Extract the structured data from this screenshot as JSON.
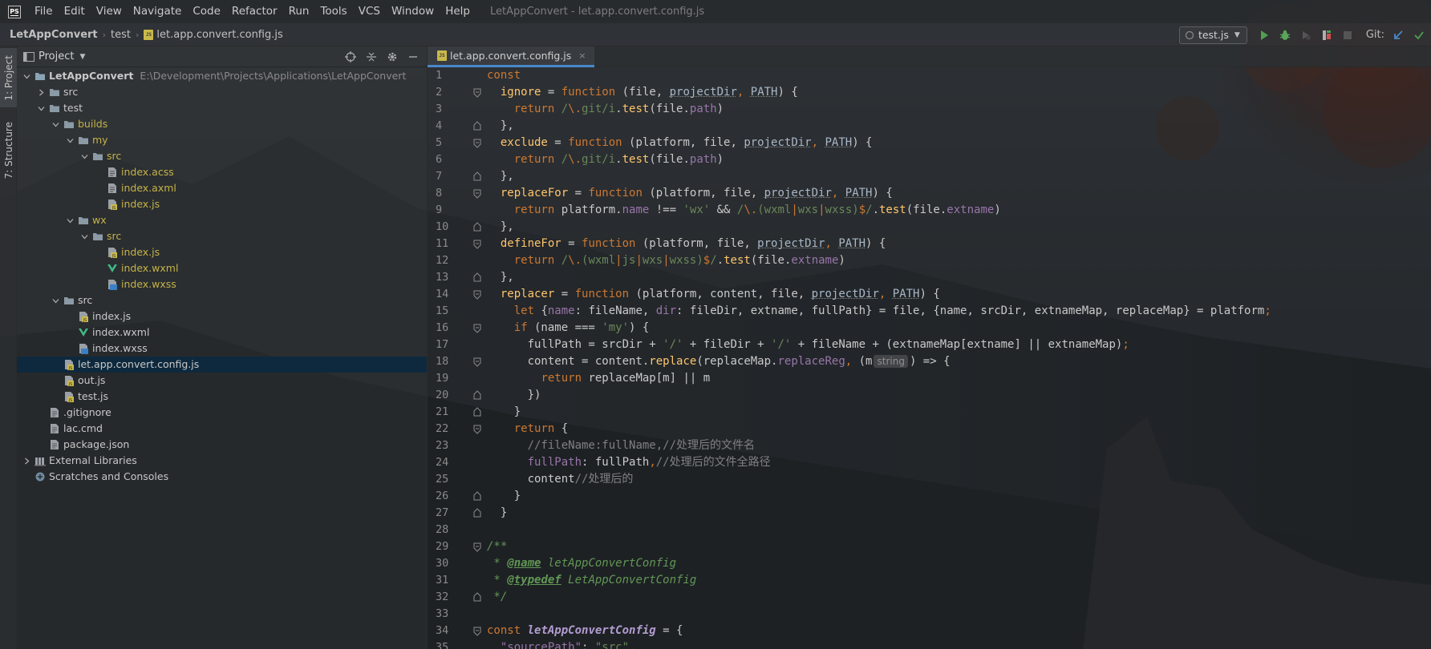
{
  "menu": {
    "app_logo": "PS",
    "items": [
      "File",
      "Edit",
      "View",
      "Navigate",
      "Code",
      "Refactor",
      "Run",
      "Tools",
      "VCS",
      "Window",
      "Help"
    ],
    "window_title": "LetAppConvert - let.app.convert.config.js"
  },
  "navbar": {
    "breadcrumbs": [
      "LetAppConvert",
      "test",
      "let.app.convert.config.js"
    ],
    "run_config": "test.js",
    "git_label": "Git:"
  },
  "tool_stripe": {
    "project_tab": "1: Project",
    "structure_tab": "7: Structure"
  },
  "project_panel": {
    "title": "Project",
    "tree": [
      {
        "label": "LetAppConvert",
        "path": "E:\\Development\\Projects\\Applications\\LetAppConvert",
        "depth": 0,
        "type": "module",
        "expanded": true,
        "bold": true
      },
      {
        "label": "src",
        "depth": 1,
        "type": "folder",
        "expanded": false
      },
      {
        "label": "test",
        "depth": 1,
        "type": "folder",
        "expanded": true
      },
      {
        "label": "builds",
        "depth": 2,
        "type": "folder",
        "expanded": true,
        "excluded": true
      },
      {
        "label": "my",
        "depth": 3,
        "type": "folder",
        "expanded": true,
        "excluded": true
      },
      {
        "label": "src",
        "depth": 4,
        "type": "folder",
        "expanded": true,
        "excluded": true
      },
      {
        "label": "index.acss",
        "depth": 5,
        "type": "file",
        "excluded": true
      },
      {
        "label": "index.axml",
        "depth": 5,
        "type": "file",
        "excluded": true
      },
      {
        "label": "index.js",
        "depth": 5,
        "type": "js",
        "excluded": true
      },
      {
        "label": "wx",
        "depth": 3,
        "type": "folder",
        "expanded": true,
        "excluded": true
      },
      {
        "label": "src",
        "depth": 4,
        "type": "folder",
        "expanded": true,
        "excluded": true
      },
      {
        "label": "index.js",
        "depth": 5,
        "type": "js",
        "excluded": true
      },
      {
        "label": "index.wxml",
        "depth": 5,
        "type": "vue",
        "excluded": true
      },
      {
        "label": "index.wxss",
        "depth": 5,
        "type": "css",
        "excluded": true
      },
      {
        "label": "src",
        "depth": 2,
        "type": "folder",
        "expanded": true
      },
      {
        "label": "index.js",
        "depth": 3,
        "type": "js"
      },
      {
        "label": "index.wxml",
        "depth": 3,
        "type": "vue"
      },
      {
        "label": "index.wxss",
        "depth": 3,
        "type": "css"
      },
      {
        "label": "let.app.convert.config.js",
        "depth": 2,
        "type": "js",
        "selected": true
      },
      {
        "label": "out.js",
        "depth": 2,
        "type": "js"
      },
      {
        "label": "test.js",
        "depth": 2,
        "type": "js"
      },
      {
        "label": ".gitignore",
        "depth": 1,
        "type": "file"
      },
      {
        "label": "lac.cmd",
        "depth": 1,
        "type": "file"
      },
      {
        "label": "package.json",
        "depth": 1,
        "type": "file"
      },
      {
        "label": "External Libraries",
        "depth": 0,
        "type": "libs",
        "expanded": false
      },
      {
        "label": "Scratches and Consoles",
        "depth": 0,
        "type": "scratch"
      }
    ]
  },
  "editor": {
    "tab_label": "let.app.convert.config.js",
    "close_glyph": "×",
    "folds": {
      "2": "o",
      "4": "c",
      "5": "o",
      "7": "c",
      "8": "o",
      "10": "c",
      "11": "o",
      "13": "c",
      "14": "o",
      "16": "o",
      "18": "o",
      "20": "c",
      "21": "c",
      "22": "o",
      "26": "c",
      "27": "c",
      "29": "o",
      "32": "c",
      "34": "o"
    },
    "lines": [
      [
        [
          "const",
          "kw"
        ]
      ],
      [
        [
          "  ",
          ""
        ],
        [
          "ignore",
          "fn"
        ],
        [
          " = ",
          ""
        ],
        [
          "function",
          "kw"
        ],
        [
          " (file, ",
          ""
        ],
        [
          "projectDir",
          "pm"
        ],
        [
          ", ",
          "kw"
        ],
        [
          "PATH",
          "pm"
        ],
        [
          ") {",
          ""
        ]
      ],
      [
        [
          "    ",
          ""
        ],
        [
          "return",
          "kw"
        ],
        [
          " /",
          "rg"
        ],
        [
          "\\.",
          "rm"
        ],
        [
          "git/i",
          "rg"
        ],
        [
          ".",
          ""
        ],
        [
          "test",
          "fn"
        ],
        [
          "(file.",
          ""
        ],
        [
          "path",
          "pr"
        ],
        [
          ")",
          ""
        ]
      ],
      [
        [
          "  },",
          ""
        ]
      ],
      [
        [
          "  ",
          ""
        ],
        [
          "exclude",
          "fn"
        ],
        [
          " = ",
          ""
        ],
        [
          "function",
          "kw"
        ],
        [
          " (platform, file, ",
          ""
        ],
        [
          "projectDir",
          "pm"
        ],
        [
          ", ",
          "kw"
        ],
        [
          "PATH",
          "pm"
        ],
        [
          ") {",
          ""
        ]
      ],
      [
        [
          "    ",
          ""
        ],
        [
          "return",
          "kw"
        ],
        [
          " /",
          "rg"
        ],
        [
          "\\.",
          "rm"
        ],
        [
          "git/i",
          "rg"
        ],
        [
          ".",
          ""
        ],
        [
          "test",
          "fn"
        ],
        [
          "(file.",
          ""
        ],
        [
          "path",
          "pr"
        ],
        [
          ")",
          ""
        ]
      ],
      [
        [
          "  },",
          ""
        ]
      ],
      [
        [
          "  ",
          ""
        ],
        [
          "replaceFor",
          "fn"
        ],
        [
          " = ",
          ""
        ],
        [
          "function",
          "kw"
        ],
        [
          " (platform, file, ",
          ""
        ],
        [
          "projectDir",
          "pm"
        ],
        [
          ", ",
          "kw"
        ],
        [
          "PATH",
          "pm"
        ],
        [
          ") {",
          ""
        ]
      ],
      [
        [
          "    ",
          ""
        ],
        [
          "return",
          "kw"
        ],
        [
          " platform.",
          ""
        ],
        [
          "name",
          "pr"
        ],
        [
          " !== ",
          ""
        ],
        [
          "'wx'",
          "st"
        ],
        [
          " && ",
          ""
        ],
        [
          "/",
          "rg"
        ],
        [
          "\\.",
          "rm"
        ],
        [
          "(",
          "rg"
        ],
        [
          "wxml",
          "rg"
        ],
        [
          "|",
          "rm"
        ],
        [
          "wxs",
          "rg"
        ],
        [
          "|",
          "rm"
        ],
        [
          "wxss)",
          "rg"
        ],
        [
          "$",
          "rm"
        ],
        [
          "/",
          "rg"
        ],
        [
          ".",
          ""
        ],
        [
          "test",
          "fn"
        ],
        [
          "(file.",
          ""
        ],
        [
          "extname",
          "pr"
        ],
        [
          ")",
          ""
        ]
      ],
      [
        [
          "  },",
          ""
        ]
      ],
      [
        [
          "  ",
          ""
        ],
        [
          "defineFor",
          "fn"
        ],
        [
          " = ",
          ""
        ],
        [
          "function",
          "kw"
        ],
        [
          " (platform, file, ",
          ""
        ],
        [
          "projectDir",
          "pm"
        ],
        [
          ", ",
          "kw"
        ],
        [
          "PATH",
          "pm"
        ],
        [
          ") {",
          ""
        ]
      ],
      [
        [
          "    ",
          ""
        ],
        [
          "return",
          "kw"
        ],
        [
          " /",
          "rg"
        ],
        [
          "\\.",
          "rm"
        ],
        [
          "(wxml",
          "rg"
        ],
        [
          "|",
          "rm"
        ],
        [
          "js",
          "rg"
        ],
        [
          "|",
          "rm"
        ],
        [
          "wxs",
          "rg"
        ],
        [
          "|",
          "rm"
        ],
        [
          "wxss)",
          "rg"
        ],
        [
          "$",
          "rm"
        ],
        [
          "/",
          "rg"
        ],
        [
          ".",
          ""
        ],
        [
          "test",
          "fn"
        ],
        [
          "(file.",
          ""
        ],
        [
          "extname",
          "pr"
        ],
        [
          ")",
          ""
        ]
      ],
      [
        [
          "  },",
          ""
        ]
      ],
      [
        [
          "  ",
          ""
        ],
        [
          "replacer",
          "fn"
        ],
        [
          " = ",
          ""
        ],
        [
          "function",
          "kw"
        ],
        [
          " (platform, content, file, ",
          ""
        ],
        [
          "projectDir",
          "pm"
        ],
        [
          ", ",
          "kw"
        ],
        [
          "PATH",
          "pm"
        ],
        [
          ") {",
          ""
        ]
      ],
      [
        [
          "    ",
          ""
        ],
        [
          "let",
          "kw"
        ],
        [
          " {",
          ""
        ],
        [
          "name",
          "pr"
        ],
        [
          ": fileName, ",
          ""
        ],
        [
          "dir",
          "pr"
        ],
        [
          ": fileDir, extname, fullPath} = file, {name, srcDir, extnameMap, replaceMap} = platform",
          ""
        ],
        [
          ";",
          "kw"
        ]
      ],
      [
        [
          "    ",
          ""
        ],
        [
          "if",
          "kw"
        ],
        [
          " (name === ",
          ""
        ],
        [
          "'my'",
          "st"
        ],
        [
          ") {",
          ""
        ]
      ],
      [
        [
          "      fullPath = srcDir + ",
          ""
        ],
        [
          "'/'",
          "st"
        ],
        [
          " + fileDir + ",
          ""
        ],
        [
          "'/'",
          "st"
        ],
        [
          " + fileName + (extnameMap[extname] || extnameMap)",
          ""
        ],
        [
          ";",
          "kw"
        ]
      ],
      [
        [
          "      content = content.",
          ""
        ],
        [
          "replace",
          "fn"
        ],
        [
          "(replaceMap.",
          ""
        ],
        [
          "replaceReg",
          "pr"
        ],
        [
          ", ",
          "kw"
        ],
        [
          "(m",
          ""
        ],
        [
          "HINT:string",
          "hint"
        ],
        [
          ") => {",
          ""
        ]
      ],
      [
        [
          "        ",
          ""
        ],
        [
          "return",
          "kw"
        ],
        [
          " replaceMap[m] || m",
          ""
        ]
      ],
      [
        [
          "      })",
          ""
        ]
      ],
      [
        [
          "    }",
          ""
        ]
      ],
      [
        [
          "    ",
          ""
        ],
        [
          "return",
          "kw"
        ],
        [
          " {",
          ""
        ]
      ],
      [
        [
          "      ",
          ""
        ],
        [
          "//fileName:fullName,//处理后的文件名",
          "cm"
        ]
      ],
      [
        [
          "      ",
          ""
        ],
        [
          "fullPath",
          "pr"
        ],
        [
          ": fullPath",
          ""
        ],
        [
          ",",
          "kw"
        ],
        [
          "//处理后的文件全路径",
          "cm"
        ]
      ],
      [
        [
          "      content",
          ""
        ],
        [
          "//处理后的",
          "cm"
        ]
      ],
      [
        [
          "    }",
          ""
        ]
      ],
      [
        [
          "  }",
          ""
        ]
      ],
      [
        [
          "",
          ""
        ]
      ],
      [
        [
          "/**",
          "jd"
        ]
      ],
      [
        [
          " * ",
          "jd"
        ],
        [
          "@name",
          "jt"
        ],
        [
          " letAppConvertConfig",
          "jd"
        ]
      ],
      [
        [
          " * ",
          "jd"
        ],
        [
          "@typedef",
          "jt"
        ],
        [
          " LetAppConvertConfig",
          "jd"
        ]
      ],
      [
        [
          " */",
          "jd"
        ]
      ],
      [
        [
          "",
          ""
        ]
      ],
      [
        [
          "const",
          "kw"
        ],
        [
          " ",
          ""
        ],
        [
          "letAppConvertConfig",
          "dc"
        ],
        [
          " = {",
          ""
        ]
      ],
      [
        [
          "  ",
          ""
        ],
        [
          "\"sourcePath\"",
          "pr"
        ],
        [
          ": ",
          ""
        ],
        [
          "\"src\"",
          "st"
        ],
        [
          ",",
          "kw"
        ]
      ]
    ]
  },
  "colors": {
    "accent": "#4a88c7",
    "selection": "#0d293e",
    "excluded_folder": "#c5b248",
    "keyword": "#cc7832",
    "function": "#ffc66d",
    "string": "#6a8759",
    "property": "#9876aa"
  }
}
